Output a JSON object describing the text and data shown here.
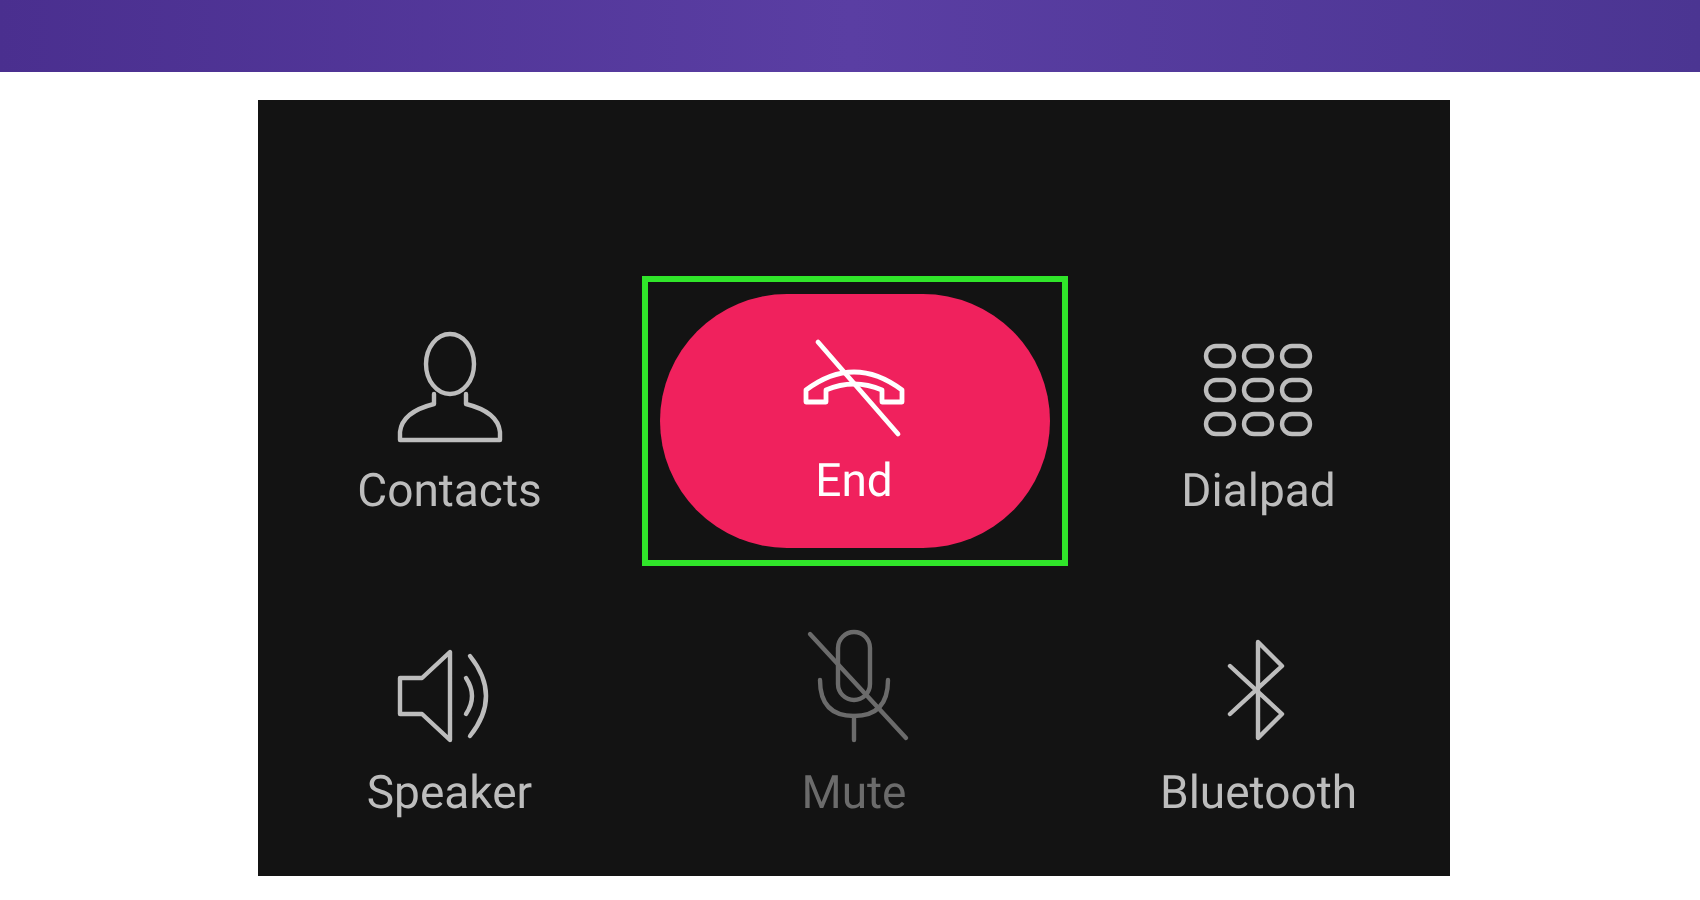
{
  "call_controls": [
    {
      "label": "Contacts",
      "kind": "action",
      "highlighted": false,
      "disabled": false
    },
    {
      "label": "End",
      "kind": "end",
      "highlighted": true,
      "disabled": false
    },
    {
      "label": "Dialpad",
      "kind": "action",
      "highlighted": false,
      "disabled": false
    },
    {
      "label": "Speaker",
      "kind": "action",
      "highlighted": false,
      "disabled": false
    },
    {
      "label": "Mute",
      "kind": "action",
      "highlighted": false,
      "disabled": true
    },
    {
      "label": "Bluetooth",
      "kind": "action",
      "highlighted": false,
      "disabled": false
    }
  ]
}
